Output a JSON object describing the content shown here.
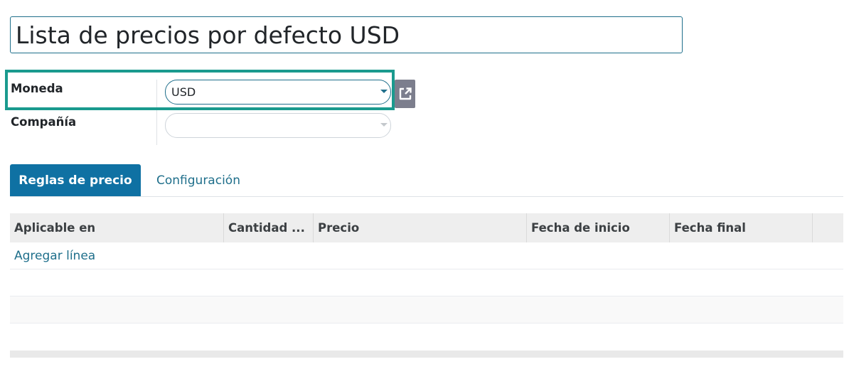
{
  "form": {
    "title": "Lista de precios por defecto USD",
    "currency_label": "Moneda",
    "currency_value": "USD",
    "company_label": "Compañía",
    "company_value": ""
  },
  "tabs": [
    {
      "label": "Reglas de precio",
      "active": true
    },
    {
      "label": "Configuración",
      "active": false
    }
  ],
  "table": {
    "columns": [
      "Aplicable en",
      "Cantidad ...",
      "Precio",
      "Fecha de inicio",
      "Fecha final",
      ""
    ],
    "add_line_label": "Agregar línea"
  },
  "icons": {
    "external_link": "external-link-icon",
    "dropdown": "caret-down-icon"
  },
  "colors": {
    "accent": "#0f71a3",
    "link": "#1f6f8b",
    "highlight": "#1a9a8e",
    "button_gray": "#7c7e8d"
  }
}
